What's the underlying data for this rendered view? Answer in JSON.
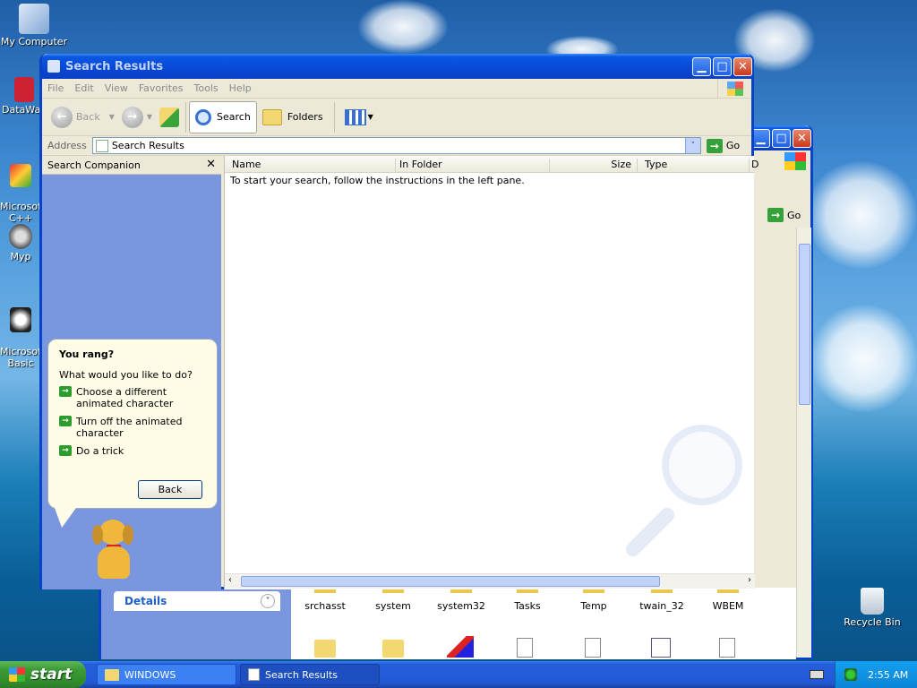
{
  "desktop": {
    "icons": [
      {
        "label": "My Computer",
        "icon": "my-computer-icon"
      },
      {
        "label": "DataWa",
        "icon": "shortcut-icon"
      },
      {
        "label": "Microsoft\nC++",
        "icon": "visual-cpp-icon"
      },
      {
        "label": "Myp",
        "icon": "raccoon-icon"
      },
      {
        "label": "Microsoft\nBasic",
        "icon": "basic-icon"
      },
      {
        "label": "Recycle Bin",
        "icon": "recycle-bin-icon"
      }
    ]
  },
  "back_window": {
    "go_label": "Go",
    "details_label": "Details",
    "folders": [
      {
        "label": "srchasst"
      },
      {
        "label": "system"
      },
      {
        "label": "system32"
      },
      {
        "label": "Tasks"
      },
      {
        "label": "Temp"
      },
      {
        "label": "twain_32"
      },
      {
        "label": "WBEM"
      }
    ]
  },
  "window": {
    "title": "Search Results",
    "menu": [
      "File",
      "Edit",
      "View",
      "Favorites",
      "Tools",
      "Help"
    ],
    "toolbar": {
      "back_label": "Back",
      "search_label": "Search",
      "folders_label": "Folders"
    },
    "address": {
      "label": "Address",
      "value": "Search Results",
      "go_label": "Go"
    },
    "companion": {
      "title": "Search Companion",
      "balloon_heading": "You rang?",
      "balloon_question": "What would you like to do?",
      "options": [
        "Choose a different animated character",
        "Turn off the animated character",
        "Do a trick"
      ],
      "back_button": "Back"
    },
    "columns": [
      "Name",
      "In Folder",
      "Size",
      "Type",
      "D"
    ],
    "empty_message": "To start your search, follow the instructions in the left pane."
  },
  "taskbar": {
    "start_label": "start",
    "tasks": [
      {
        "label": "WINDOWS",
        "active": false
      },
      {
        "label": "Search Results",
        "active": true
      }
    ],
    "clock": "2:55 AM"
  },
  "colors": {
    "title_blue": "#0a58e2",
    "companion_pane": "#7a96df",
    "start_green": "#3c9c37"
  }
}
